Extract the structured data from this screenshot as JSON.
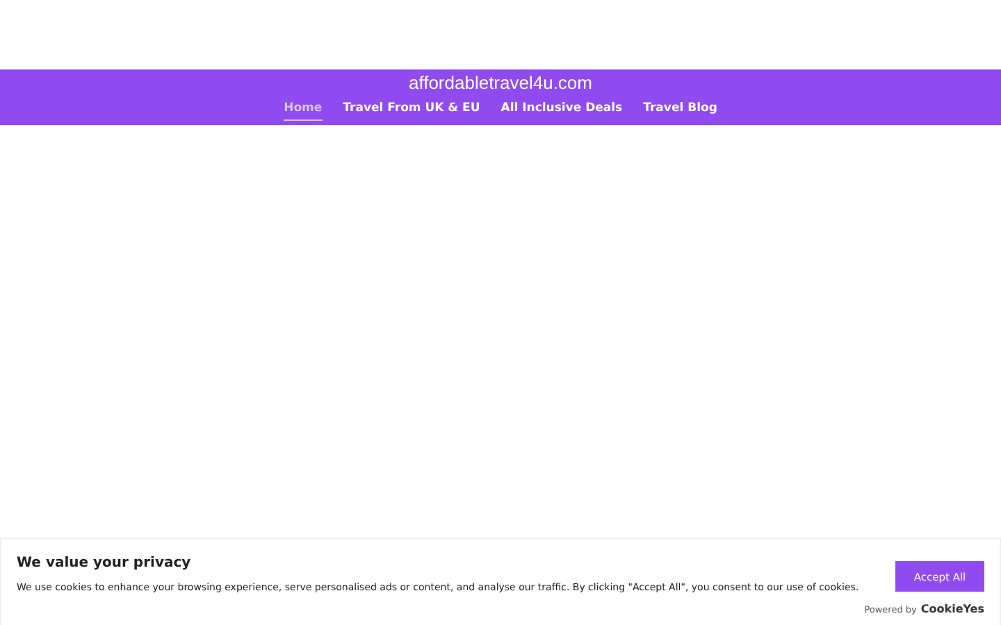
{
  "site_title": "affordabletravel4u.com",
  "nav": [
    {
      "label": "Home",
      "selected": true
    },
    {
      "label": "Travel From UK & EU",
      "selected": false
    },
    {
      "label": "All Inclusive Deals",
      "selected": false
    },
    {
      "label": "Travel Blog",
      "selected": false
    }
  ],
  "cookie_banner": {
    "title": "We value your privacy",
    "message": "We use cookies to enhance your browsing experience, serve personalised ads or content, and analyse our traffic. By clicking \"Accept All\", you consent to our use of cookies.",
    "button": "Accept All",
    "powered_by": "Powered by",
    "brand": "CookieYes"
  }
}
